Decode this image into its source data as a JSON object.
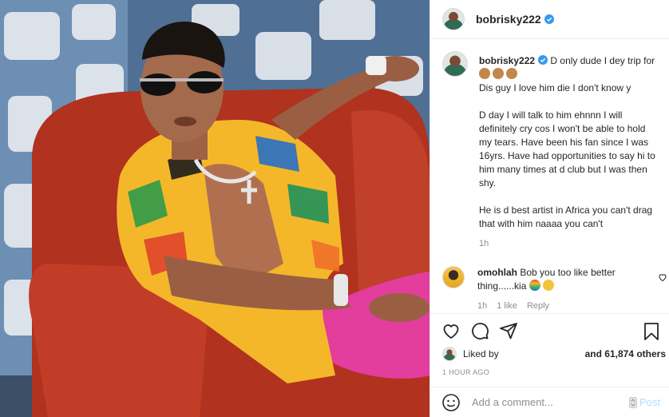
{
  "post": {
    "username": "bobrisky222",
    "caption": "D only dude I dey trip for",
    "caption_body": "Dis guy I love him die I don't know y\n\nD day I will talk to him ehnnn I will definitely cry cos I won't be able to hold my tears. Have been his fan since I was 16yrs. Have had opportunities to say hi to him many times at d club but I was then shy.\n\nHe is d best artist in Africa you can't drag that with him naaaa you can't",
    "caption_time": "1h"
  },
  "comment": {
    "username": "omohlah",
    "text": "Bob you too like better thing......kia",
    "time": "1h",
    "likes": "1 like",
    "reply": "Reply"
  },
  "likes": {
    "liked_by": "Liked by",
    "others": "and 61,874 others"
  },
  "timestamp": "1 HOUR AGO",
  "add_comment": {
    "placeholder": "Add a comment...",
    "post_label": "Post"
  },
  "icons": {
    "header_avatar": "avatar",
    "verified": "verified-badge-icon",
    "like": "heart-icon",
    "comment": "comment-icon",
    "share": "share-icon",
    "save": "bookmark-icon",
    "emoji": "emoji-icon"
  },
  "colors": {
    "verified": "#3897f0",
    "post_button": "#b2dffc",
    "muted": "#8e8e8e",
    "border": "#efefef"
  }
}
